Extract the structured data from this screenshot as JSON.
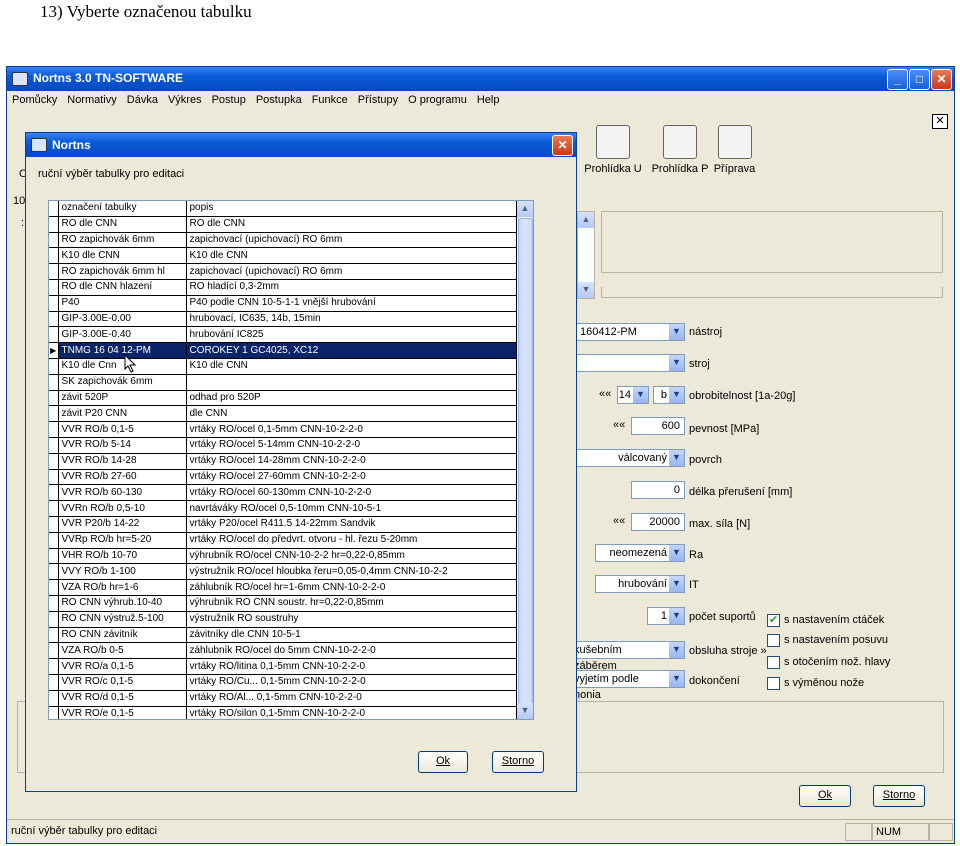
{
  "heading": "13)  Vyberte označenou tabulku",
  "main": {
    "title": "Nortns 3.0 TN-SOFTWARE",
    "menu": [
      "Pomůcky",
      "Normativy",
      "Dávka",
      "Výkres",
      "Postup",
      "Postupka",
      "Funkce",
      "Přístupy",
      "O programu",
      "Help"
    ],
    "toolbar": [
      "Prohlídka U",
      "Prohlídka P",
      "Příprava"
    ],
    "left_fragments": [
      "O",
      "10",
      ":"
    ],
    "combos": {
      "nastroj_value": "160412-PM",
      "nastroj_label": "nástroj",
      "stroj_value": "",
      "stroj_label": "stroj",
      "obrob_arrows": "«",
      "obrob_value": "14",
      "obrob_letter": "b",
      "obrob_label": "obrobitelnost [1a-20g]",
      "pevnost_arrows": "«",
      "pevnost_value": "600",
      "pevnost_label": "pevnost [MPa]",
      "povrch_value": "válcovaný",
      "povrch_label": "povrch",
      "preruseni_value": "0",
      "preruseni_label": "délka přerušení [mm]",
      "sila_arrows": "«",
      "sila_value": "20000",
      "sila_label": "max. síla [N]",
      "ra_value": "neomezená",
      "ra_label": "Ra",
      "it_value": "hrubování",
      "it_label": "IT",
      "suporty_value": "1",
      "suporty_label": "počet suportů",
      "obsluha_value": "kušebním záběrem",
      "obsluha_label": "obsluha stroje »",
      "dokonceni_value": "vyjetím podle nonia",
      "dokonceni_label": "dokončení"
    },
    "checkboxes": [
      {
        "label": "s nastavením ctáček",
        "checked": true
      },
      {
        "label": "s nastavením posuvu",
        "checked": false
      },
      {
        "label": "s otočením nož. hlavy",
        "checked": false
      },
      {
        "label": "s výměnou nože",
        "checked": false
      }
    ],
    "ok_label": "Ok",
    "cancel_label": "Storno",
    "status_text": "ruční výběr tabulky pro editaci",
    "status_num": "NUM"
  },
  "dialog": {
    "title": "Nortns",
    "subtitle": "ruční výběr tabulky pro editaci",
    "columns": [
      "označení tabulky",
      "popis"
    ],
    "rows": [
      [
        "RO dle CNN",
        "RO dle CNN"
      ],
      [
        "RO zapichovák 6mm",
        "zapichovací (upichovací) RO 6mm"
      ],
      [
        "K10 dle CNN",
        "K10 dle CNN"
      ],
      [
        "RO zapichovák 6mm hl",
        "zapichovací (upichovací) RO 6mm"
      ],
      [
        "RO dle CNN hlazení",
        "RO hladící 0,3-2mm"
      ],
      [
        "P40",
        "P40 podle CNN 10-5-1-1 vnější hrubování"
      ],
      [
        "GIP-3.00E-0.00",
        "hrubovací, IC635, 14b, 15min"
      ],
      [
        "GIP-3.00E-0.40",
        "hrubování IC825"
      ],
      [
        "TNMG 16 04 12-PM",
        "COROKEY 1     GC4025, XC12"
      ],
      [
        "K10 dle Cnn",
        "K10 dle CNN"
      ],
      [
        "SK zapichovák 6mm",
        ""
      ],
      [
        "závit 520P",
        "odhad pro 520P"
      ],
      [
        "závit P20 CNN",
        "dle CNN"
      ],
      [
        "VVR RO/b 0,1-5",
        "vrtáky RO/ocel 0,1-5mm CNN-10-2-2-0"
      ],
      [
        "VVR RO/b 5-14",
        "vrtáky RO/ocel 5-14mm CNN-10-2-2-0"
      ],
      [
        "VVR RO/b 14-28",
        "vrtáky RO/ocel 14-28mm CNN-10-2-2-0"
      ],
      [
        "VVR RO/b 27-60",
        "vrtáky RO/ocel 27-60mm CNN-10-2-2-0"
      ],
      [
        "VVR RO/b 60-130",
        "vrtáky RO/ocel 60-130mm CNN-10-2-2-0"
      ],
      [
        "VVRn RO/b 0,5-10",
        "navrtáváky RO/ocel 0,5-10mm CNN-10-5-1"
      ],
      [
        "VVR P20/b 14-22",
        "vrtáky P20/ocel R411.5 14-22mm Sandvik"
      ],
      [
        "VVRp RO/b hr=5-20",
        "vrtáky RO/ocel do předvrt. otvoru - hl. řezu 5-20mm"
      ],
      [
        "VHR RO/b 10-70",
        "výhrubník RO/ocel CNN-10-2-2 hr=0,22-0,85mm"
      ],
      [
        "VVY RO/b 1-100",
        "výstružník RO/ocel hloubka řeru=0,05-0,4mm CNN-10-2-2"
      ],
      [
        "VZA RO/b hr=1-6",
        "záhlubník RO/ocel hr=1-6mm CNN-10-2-2-0"
      ],
      [
        "RO CNN výhrub.10-40",
        "výhrubník RO CNN soustr. hr=0,22-0,85mm"
      ],
      [
        "RO CNN výstruž.5-100",
        "výstružník RO soustruhy"
      ],
      [
        "RO CNN závitník",
        "závitníky dle CNN 10-5-1"
      ],
      [
        "VZA RO/b 0-5",
        "záhlubník RO/ocel do 5mm CNN-10-2-2-0"
      ],
      [
        "VVR RO/a 0,1-5",
        "vrtáky RO/litina 0,1-5mm CNN-10-2-2-0"
      ],
      [
        "VVR RO/c 0,1-5",
        "vrtáky RO/Cu... 0,1-5mm CNN-10-2-2-0"
      ],
      [
        "VVR RO/d 0,1-5",
        "vrtáky RO/Al... 0,1-5mm CNN-10-2-2-0"
      ],
      [
        "VVR RO/e 0,1-5",
        "vrtáky RO/silon 0,1-5mm CNN-10-2-2-0"
      ]
    ],
    "selected_index": 8,
    "ok_label": "Ok",
    "cancel_label": "Storno"
  }
}
